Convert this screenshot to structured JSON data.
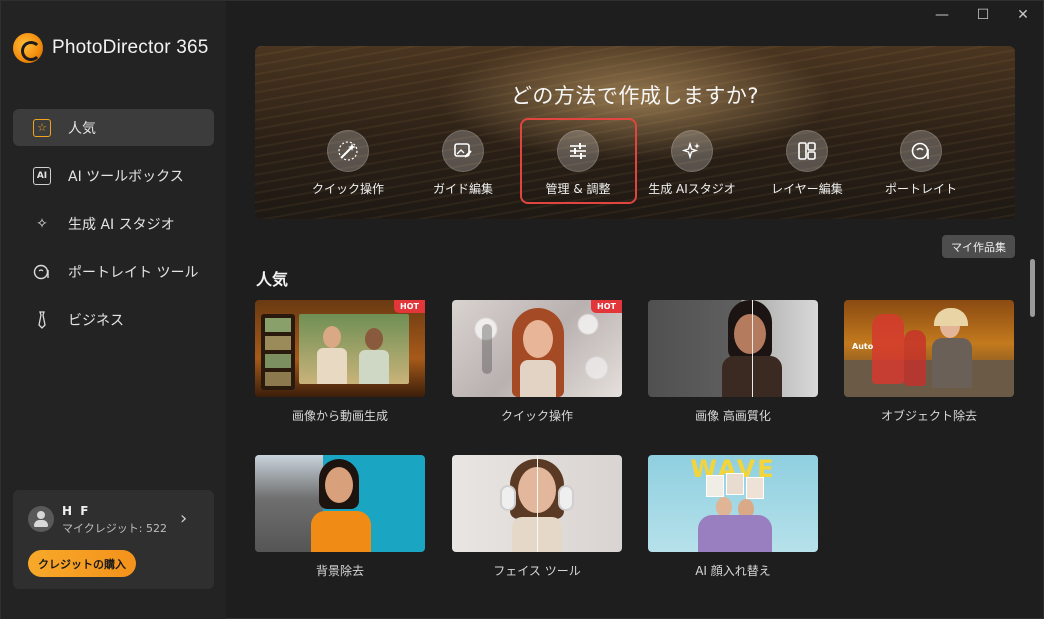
{
  "app": {
    "title": "PhotoDirector 365"
  },
  "window_controls": {
    "minimize": "—",
    "maximize": "☐",
    "close": "✕"
  },
  "sidebar": {
    "items": [
      {
        "label": "人気",
        "icon": "star-icon",
        "active": true
      },
      {
        "label": "AI ツールボックス",
        "icon": "ai-toolbox-icon",
        "active": false
      },
      {
        "label": "生成 AI スタジオ",
        "icon": "sparkle-icon",
        "active": false
      },
      {
        "label": "ポートレイト ツール",
        "icon": "portrait-icon",
        "active": false
      },
      {
        "label": "ビジネス",
        "icon": "tie-icon",
        "active": false
      }
    ]
  },
  "account": {
    "name": "H F",
    "credits": "マイクレジット: 522",
    "buy_label": "クレジットの購入"
  },
  "hero": {
    "title": "どの方法で作成しますか?",
    "tools": [
      {
        "label": "クイック操作",
        "icon": "magic-wand-icon",
        "highlighted": false
      },
      {
        "label": "ガイド編集",
        "icon": "guided-edit-icon",
        "highlighted": false
      },
      {
        "label": "管理 & 調整",
        "icon": "sliders-icon",
        "highlighted": true
      },
      {
        "label": "生成 AIスタジオ",
        "icon": "sparkle-icon",
        "highlighted": false
      },
      {
        "label": "レイヤー編集",
        "icon": "layers-icon",
        "highlighted": false
      },
      {
        "label": "ポートレイト",
        "icon": "portrait-icon",
        "highlighted": false
      }
    ]
  },
  "my_works_label": "マイ作品集",
  "section": {
    "title": "人気"
  },
  "cards": [
    {
      "label": "画像から動画生成",
      "badge": "HOT"
    },
    {
      "label": "クイック操作",
      "badge": "HOT"
    },
    {
      "label": "画像 高画質化",
      "badge": ""
    },
    {
      "label": "オブジェクト除去",
      "badge": "",
      "thumb_text": "Auto"
    },
    {
      "label": "背景除去",
      "badge": ""
    },
    {
      "label": "フェイス ツール",
      "badge": ""
    },
    {
      "label": "AI 顔入れ替え",
      "badge": "",
      "thumb_text": "WAVE"
    }
  ],
  "colors": {
    "accent_orange": "#f4a22a",
    "hot_badge": "#e2363a",
    "highlight_border": "#e0453f",
    "sidebar_bg": "#232323",
    "main_bg": "#1e1e1e"
  }
}
